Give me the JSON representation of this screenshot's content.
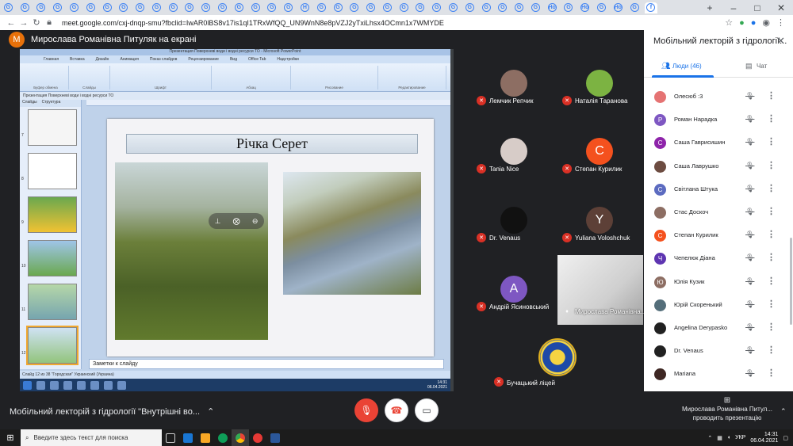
{
  "browser": {
    "tabs": [
      "G",
      "G",
      "G",
      "G",
      "G",
      "G",
      "G",
      "G",
      "G",
      "G",
      "G",
      "G",
      "G",
      "G",
      "G",
      "G",
      "G",
      "G",
      "H",
      "G",
      "G",
      "G",
      "G",
      "G",
      "G",
      "G",
      "G",
      "G",
      "G",
      "G",
      "G",
      "G",
      "G",
      "Ho",
      "G",
      "Ho",
      "G",
      "Ho",
      "G",
      "f"
    ],
    "url": "meet.google.com/cxj-dnqp-smu?fbclid=IwAR0lBS8v17is1qI1TRxWfQQ_UN9WnN8e8pVZJ2yTxiLhsx4OCmn1x7WMYDE"
  },
  "presenter": {
    "avatar_letter": "M",
    "title": "Мирослава Романівна Питуляк на екрані"
  },
  "ppt": {
    "window_title": "Презентация Поверхневі води і водні ресурси ТО - Microsoft PowerPoint",
    "ribbon_tabs": [
      "Главная",
      "Вставка",
      "Дизайн",
      "Анимация",
      "Показ слайдов",
      "Рецензирование",
      "Вид",
      "Office Tab",
      "Надстройки"
    ],
    "ribbon_groups": [
      "Буфер обмена",
      "Слайды",
      "Шрифт",
      "Абзац",
      "Рисование",
      "Редактирование"
    ],
    "left_tabs": [
      "Слайды",
      "Структура"
    ],
    "doc_tab": "Презентация Поверхневі води і водні ресурси ТО",
    "slide_numbers": [
      "7",
      "8",
      "9",
      "10",
      "11",
      "12"
    ],
    "slide_title": "Річка Серет",
    "notes": "Заметки к слайду",
    "status": "Слайд 12 из 38    \"Городская\"    Украинский (Украина)",
    "clock_time": "14:31",
    "clock_date": "06.04.2021"
  },
  "participants_grid": [
    {
      "name": "Лемчик Репчик",
      "letter": "",
      "color": "#8d6e63"
    },
    {
      "name": "Наталія Таранова",
      "letter": "",
      "color": "#7cb342"
    },
    {
      "name": "Tania Nice",
      "letter": "",
      "color": "#d7ccc8"
    },
    {
      "name": "Степан Курилик",
      "letter": "С",
      "color": "#f4511e"
    },
    {
      "name": "Dr. Venaus",
      "letter": "",
      "color": "#111111"
    },
    {
      "name": "Yuliana Voloshchuk",
      "letter": "Y",
      "color": "#5d4037"
    },
    {
      "name": "Андрій Ясиновський",
      "letter": "А",
      "color": "#7e57c2"
    }
  ],
  "video_tile": {
    "name": "Мирослава Романівна..."
  },
  "school_tile": {
    "name": "Бучацький ліцей"
  },
  "panel": {
    "title": "Мобільний лекторій з гідрології...",
    "people_tab": "Люди (46)",
    "chat_tab": "Чат",
    "people": [
      {
        "name": "Олесюб :3",
        "letter": "",
        "color": "#e57373"
      },
      {
        "name": "Роман Нарадка",
        "letter": "Р",
        "color": "#7e57c2"
      },
      {
        "name": "Саша Гаврисишин",
        "letter": "С",
        "color": "#8e24aa"
      },
      {
        "name": "Саша Лаврушко",
        "letter": "",
        "color": "#6d4c41"
      },
      {
        "name": "Світлана Штука",
        "letter": "С",
        "color": "#5c6bc0"
      },
      {
        "name": "Стас Доскоч",
        "letter": "",
        "color": "#8d6e63"
      },
      {
        "name": "Степан Курилик",
        "letter": "С",
        "color": "#f4511e"
      },
      {
        "name": "Чепелюк Діана",
        "letter": "Ч",
        "color": "#5e35b1"
      },
      {
        "name": "Юлія Кузик",
        "letter": "Ю",
        "color": "#8d6e63"
      },
      {
        "name": "Юрій Скоренький",
        "letter": "",
        "color": "#546e7a"
      },
      {
        "name": "Angelina Derypasko",
        "letter": "",
        "color": "#212121"
      },
      {
        "name": "Dr. Venaus",
        "letter": "",
        "color": "#212121"
      },
      {
        "name": "Mariana",
        "letter": "",
        "color": "#3e2723"
      }
    ]
  },
  "meetbar": {
    "title": "Мобільний лекторій з гідрології \"Внутрішні во...",
    "presenting_name": "Мирослава Романівна Питул...",
    "presenting_label": "проводить презентацію"
  },
  "taskbar": {
    "search_placeholder": "Введите здесь текст для поиска",
    "lang": "УКР",
    "time": "14:31",
    "date": "06.04.2021"
  }
}
